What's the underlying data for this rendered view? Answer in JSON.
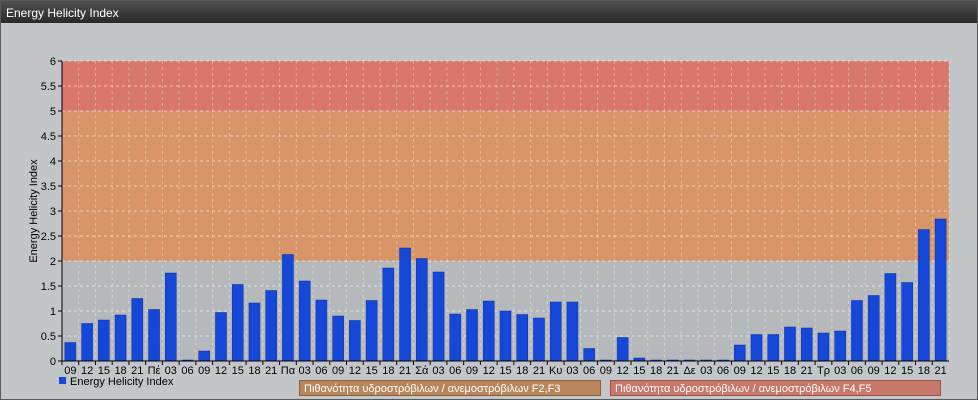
{
  "window": {
    "title": "Energy Helicity Index"
  },
  "chart_data": {
    "type": "bar",
    "title": "",
    "xlabel": "",
    "ylabel": "Energy Helicity Index",
    "ylim": [
      0,
      6
    ],
    "yticks": [
      "0",
      "0.5",
      "1",
      "1.5",
      "2",
      "2.5",
      "3",
      "3.5",
      "4",
      "4.5",
      "5",
      "5.5",
      "6"
    ],
    "grid": true,
    "categories": [
      "09",
      "12",
      "15",
      "18",
      "21",
      "Πέ",
      "03",
      "06",
      "09",
      "12",
      "15",
      "18",
      "21",
      "Πα",
      "03",
      "06",
      "09",
      "12",
      "15",
      "18",
      "21",
      "Σά",
      "03",
      "06",
      "09",
      "12",
      "15",
      "18",
      "21",
      "Κυ",
      "03",
      "06",
      "09",
      "12",
      "15",
      "18",
      "21",
      "Δε",
      "03",
      "06",
      "09",
      "12",
      "15",
      "18",
      "21",
      "Τρ",
      "03",
      "06",
      "09",
      "12",
      "15",
      "18",
      "21"
    ],
    "series": [
      {
        "name": "Energy Helicity Index",
        "values": [
          0.37,
          0.75,
          0.82,
          0.92,
          1.25,
          1.03,
          1.76,
          0.02,
          0.2,
          0.97,
          1.53,
          1.16,
          1.41,
          2.13,
          1.6,
          1.22,
          0.9,
          0.81,
          1.21,
          1.86,
          2.26,
          2.05,
          1.78,
          0.94,
          1.03,
          1.2,
          1.0,
          0.93,
          0.86,
          1.18,
          1.18,
          0.25,
          0.02,
          0.47,
          0.06,
          0.02,
          0.02,
          0.02,
          0.02,
          0.02,
          0.32,
          0.53,
          0.53,
          0.68,
          0.66,
          0.56,
          0.6,
          1.21,
          1.31,
          1.75,
          1.57,
          2.63,
          2.84
        ]
      }
    ],
    "bands": [
      {
        "from": 0,
        "to": 2,
        "color": "#b5b9bc"
      },
      {
        "from": 2,
        "to": 5,
        "color": "#d79568"
      },
      {
        "from": 5,
        "to": 6,
        "color": "#d8776a"
      }
    ],
    "legend": {
      "position": "bottom-left",
      "series_label": "Energy Helicity Index"
    },
    "zone_labels": [
      {
        "label": "Πιθανότητα υδροστρόβιλων / ανεμοστρόβιλων F2,F3",
        "color": "#b8865c"
      },
      {
        "label": "Πιθανότητα υδροστρόβιλων / ανεμοστρόβιλων F4,F5",
        "color": "#c8776a"
      }
    ],
    "colors": {
      "bar": "#1547d8",
      "bar_edge": "#0b2f9e"
    }
  }
}
